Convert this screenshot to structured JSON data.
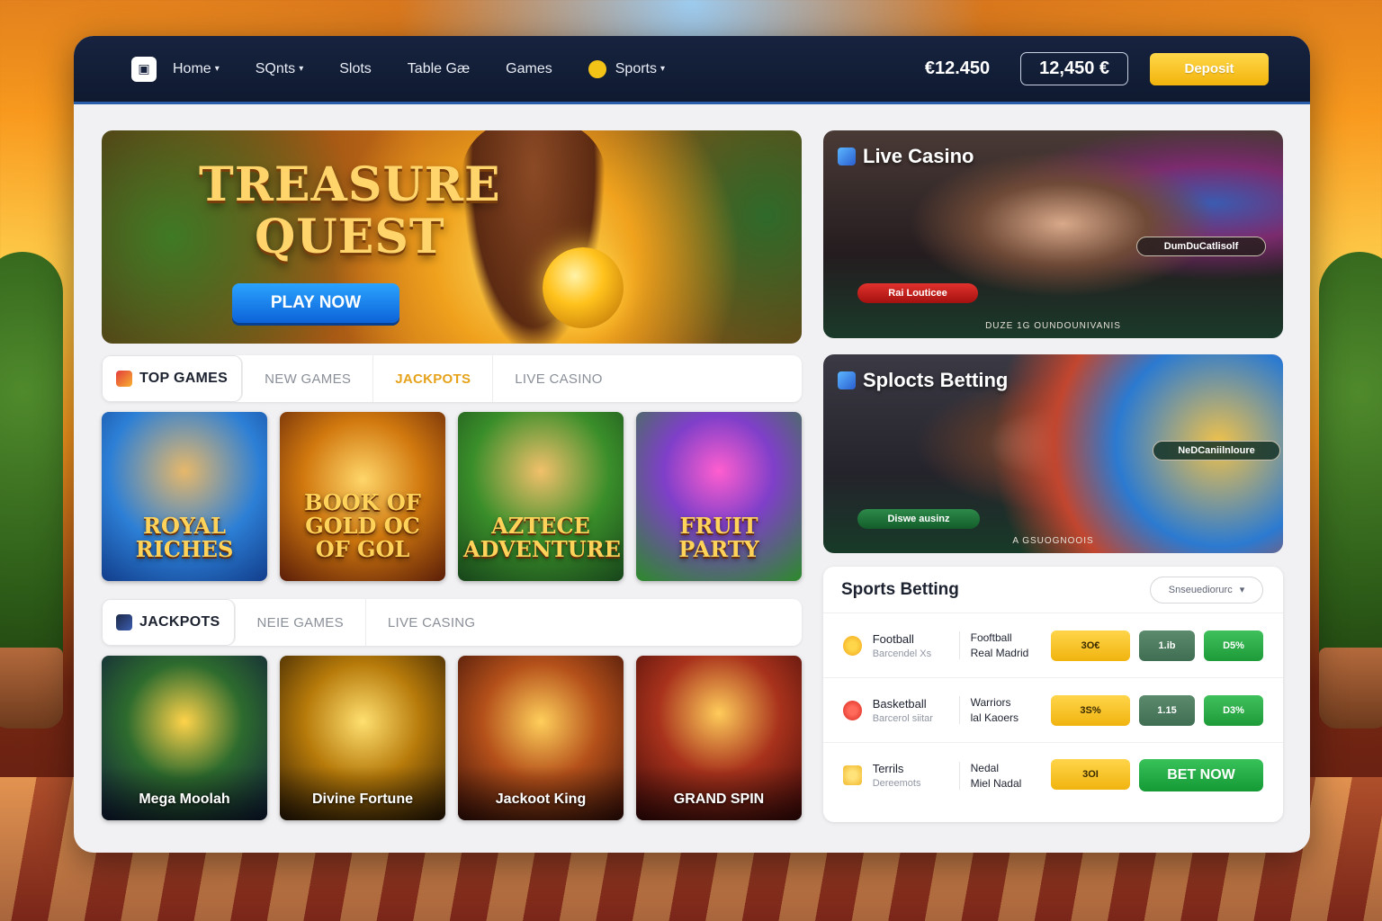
{
  "nav": {
    "items": [
      {
        "label": "Home",
        "dropdown": true
      },
      {
        "label": "SQnts",
        "dropdown": true
      },
      {
        "label": "Slots",
        "dropdown": false
      },
      {
        "label": "Table Gæ",
        "dropdown": false
      },
      {
        "label": "Games",
        "dropdown": false
      },
      {
        "label": "Sports",
        "dropdown": true
      }
    ],
    "balance_text": "€12.450",
    "balance_box": "12,450 €",
    "deposit_label": "Deposit"
  },
  "hero": {
    "title_line1": "TREASURE",
    "title_line2": "QUEST",
    "cta": "PLAY NOW"
  },
  "section1": {
    "tabs": [
      "TOP GAMES",
      "NEW GAMES",
      "JACKPOTS",
      "LIVE CASINO"
    ],
    "games": [
      {
        "title": "ROYAL RICHES"
      },
      {
        "title": "BOOK OF GOLD OC OF GOL"
      },
      {
        "title": "AZTECE ADVENTURE"
      },
      {
        "title": "FRUIT PARTY"
      }
    ]
  },
  "section2": {
    "tabs": [
      "JACKPOTS",
      "NEIE GAMES",
      "LIVE CASING"
    ],
    "games": [
      {
        "label": "Mega Moolah"
      },
      {
        "label": "Divine Fortune"
      },
      {
        "label": "Jackoot King"
      },
      {
        "label": "GRAND SPIN"
      }
    ]
  },
  "live_casino": {
    "title": "Live Casino",
    "pill_red": "Rai Louticee",
    "pill_dark": "DumDuCatlisolf",
    "caption": "DUZE 1G OUNDOUNIVANIS"
  },
  "sports_promo": {
    "title": "Splocts Betting",
    "pill_green": "Diswe ausinz",
    "pill_dark": "NeDCaniilnloure",
    "caption": "A GSUOGNOOIS"
  },
  "betting": {
    "title": "Sports Betting",
    "select_label": "Snseuediorurc",
    "rows": [
      {
        "sport": "Football",
        "sub": "Barcendel Xs",
        "team1": "Fooftball",
        "team2": "Real Madrid",
        "odd1": "3O€",
        "odd2": "1.ib",
        "odd3": "D5%"
      },
      {
        "sport": "Basketball",
        "sub": "Barcerol siitar",
        "team1": "Warriors",
        "team2": "lal Kaoers",
        "odd1": "3S%",
        "odd2": "1.15",
        "odd3": "D3%"
      },
      {
        "sport": "Terrils",
        "sub": "Dereemots",
        "team1": "Nedal",
        "team2": "Miel Nadal",
        "odd1": "3OI"
      }
    ],
    "bet_now": "BET NOW"
  },
  "colors": {
    "topbar": "#17233f",
    "accent_yellow": "#f4c318",
    "accent_blue": "#0d63d8",
    "accent_green": "#1f9b3a",
    "jackpot_gold": "#e6a21a"
  }
}
